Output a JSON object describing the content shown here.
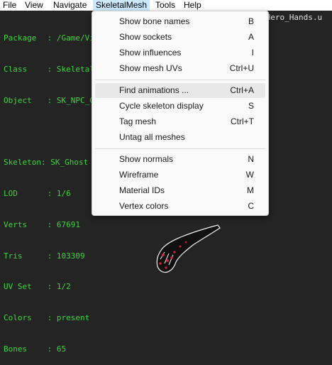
{
  "menubar": {
    "file": "File",
    "view": "View",
    "navigate": "Navigate",
    "skeletal_mesh": "SkeletalMesh",
    "tools": "Tools",
    "help": "Help"
  },
  "info": {
    "package": {
      "key": "Package",
      "sep": ":",
      "value": "/Game/Vi"
    },
    "class": {
      "key": "Class",
      "sep": ":",
      "value": "Skeletal"
    },
    "object": {
      "key": "Object",
      "sep": ":",
      "value": "SK_NPC_G"
    },
    "skeleton": {
      "key": "Skeleton",
      "sep": ":",
      "value": "SK_Ghost"
    },
    "lod": {
      "key": "LOD",
      "sep": ":",
      "value": "1/6"
    },
    "verts": {
      "key": "Verts",
      "sep": ":",
      "value": "67691"
    },
    "tris": {
      "key": "Tris",
      "sep": ":",
      "value": "103309"
    },
    "uvset": {
      "key": "UV Set",
      "sep": ":",
      "value": "1/2"
    },
    "colors": {
      "key": "Colors",
      "sep": ":",
      "value": "present"
    },
    "bones": {
      "key": "Bones",
      "sep": ":",
      "value": "65"
    },
    "package_tail": "rHero_Hands.u"
  },
  "menu": {
    "items": [
      {
        "label": "Show bone names",
        "shortcut": "B"
      },
      {
        "label": "Show sockets",
        "shortcut": "A"
      },
      {
        "label": "Show influences",
        "shortcut": "I"
      },
      {
        "label": "Show mesh UVs",
        "shortcut": "Ctrl+U"
      },
      {
        "label": "Find animations ...",
        "shortcut": "Ctrl+A"
      },
      {
        "label": "Cycle skeleton display",
        "shortcut": "S"
      },
      {
        "label": "Tag mesh",
        "shortcut": "Ctrl+T"
      },
      {
        "label": "Untag all meshes",
        "shortcut": ""
      },
      {
        "label": "Show normals",
        "shortcut": "N"
      },
      {
        "label": "Wireframe",
        "shortcut": "W"
      },
      {
        "label": "Material IDs",
        "shortcut": "M"
      },
      {
        "label": "Vertex colors",
        "shortcut": "C"
      }
    ]
  },
  "colors": {
    "viewport_bg": "#242424",
    "info_text": "#3fd43f",
    "menu_bg": "#f9f9f9",
    "menu_highlight": "#e8e8e8",
    "open_menu_highlight": "#cce8ff"
  }
}
